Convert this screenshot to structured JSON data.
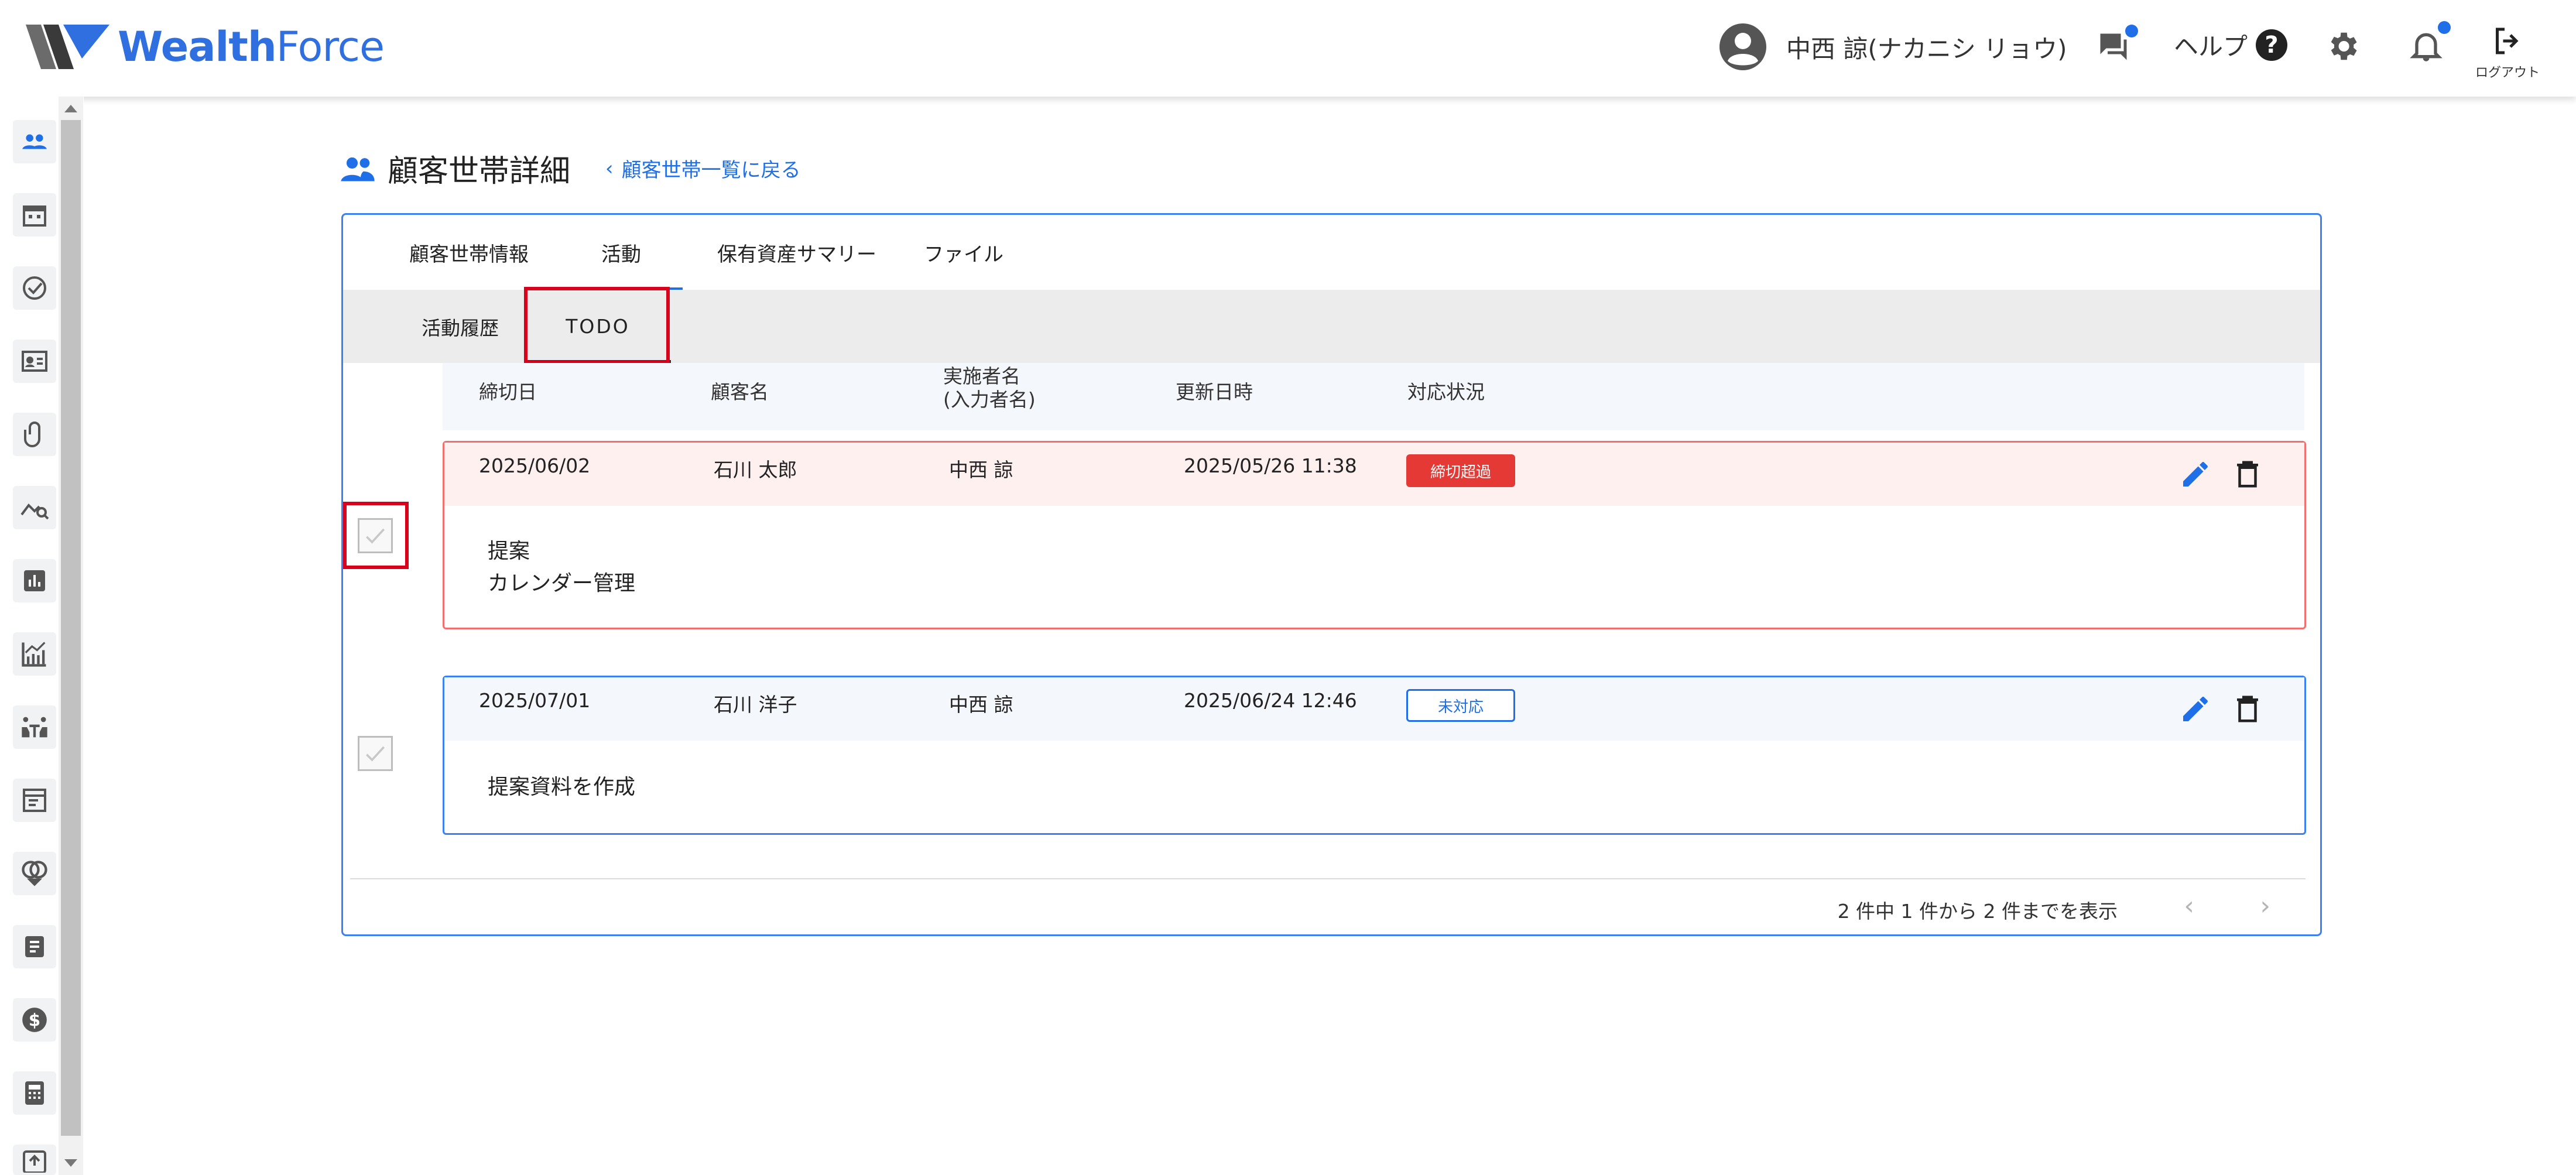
{
  "brand": {
    "name_bold": "Wealth",
    "name_light": "Force",
    "accent": "#2f6fe0"
  },
  "header": {
    "user_name": "中西 諒(ナカニシ リョウ)",
    "help_label": "ヘルプ",
    "help_symbol": "?",
    "logout_label": "ログアウト",
    "icons": [
      "account-circle-icon",
      "chat-icon",
      "help-icon",
      "gear-icon",
      "bell-icon",
      "logout-icon"
    ]
  },
  "sidebar": {
    "icons": [
      "people-icon",
      "calendar-icon",
      "check-circle-icon",
      "contact-card-icon",
      "paperclip-icon",
      "analytics-search-icon",
      "bar-chart-icon",
      "growth-chart-icon",
      "meeting-icon",
      "article-icon",
      "rings-icon",
      "document-icon",
      "dollar-icon",
      "calculator-icon",
      "upload-icon"
    ]
  },
  "page": {
    "title": "顧客世帯詳細",
    "back_link": "顧客世帯一覧に戻る",
    "back_chevron": "‹"
  },
  "tabs": [
    {
      "label": "顧客世帯情報"
    },
    {
      "label": "活動"
    },
    {
      "label": "保有資産サマリー"
    },
    {
      "label": "ファイル"
    }
  ],
  "subtabs": [
    {
      "label": "活動履歴"
    },
    {
      "label": "TODO"
    }
  ],
  "table": {
    "headers": {
      "due": "締切日",
      "customer": "顧客名",
      "assignee_line1": "実施者名",
      "assignee_line2": "(入力者名)",
      "updated": "更新日時",
      "status": "対応状況"
    }
  },
  "todos": [
    {
      "due": "2025/06/02",
      "customer": "石川 太郎",
      "assignee": "中西 諒",
      "updated": "2025/05/26 11:38",
      "status": "締切超過",
      "memo_line1": "提案",
      "memo_line2": "カレンダー管理",
      "status_color": "#e53935"
    },
    {
      "due": "2025/07/01",
      "customer": "石川 洋子",
      "assignee": "中西 諒",
      "updated": "2025/06/24 12:46",
      "status": "未対応",
      "memo_line1": "提案資料を作成",
      "status_color": "#1f6fe8"
    }
  ],
  "pager": {
    "summary": "2 件中 1 件から 2 件までを表示",
    "prev": "‹",
    "next": "›"
  }
}
